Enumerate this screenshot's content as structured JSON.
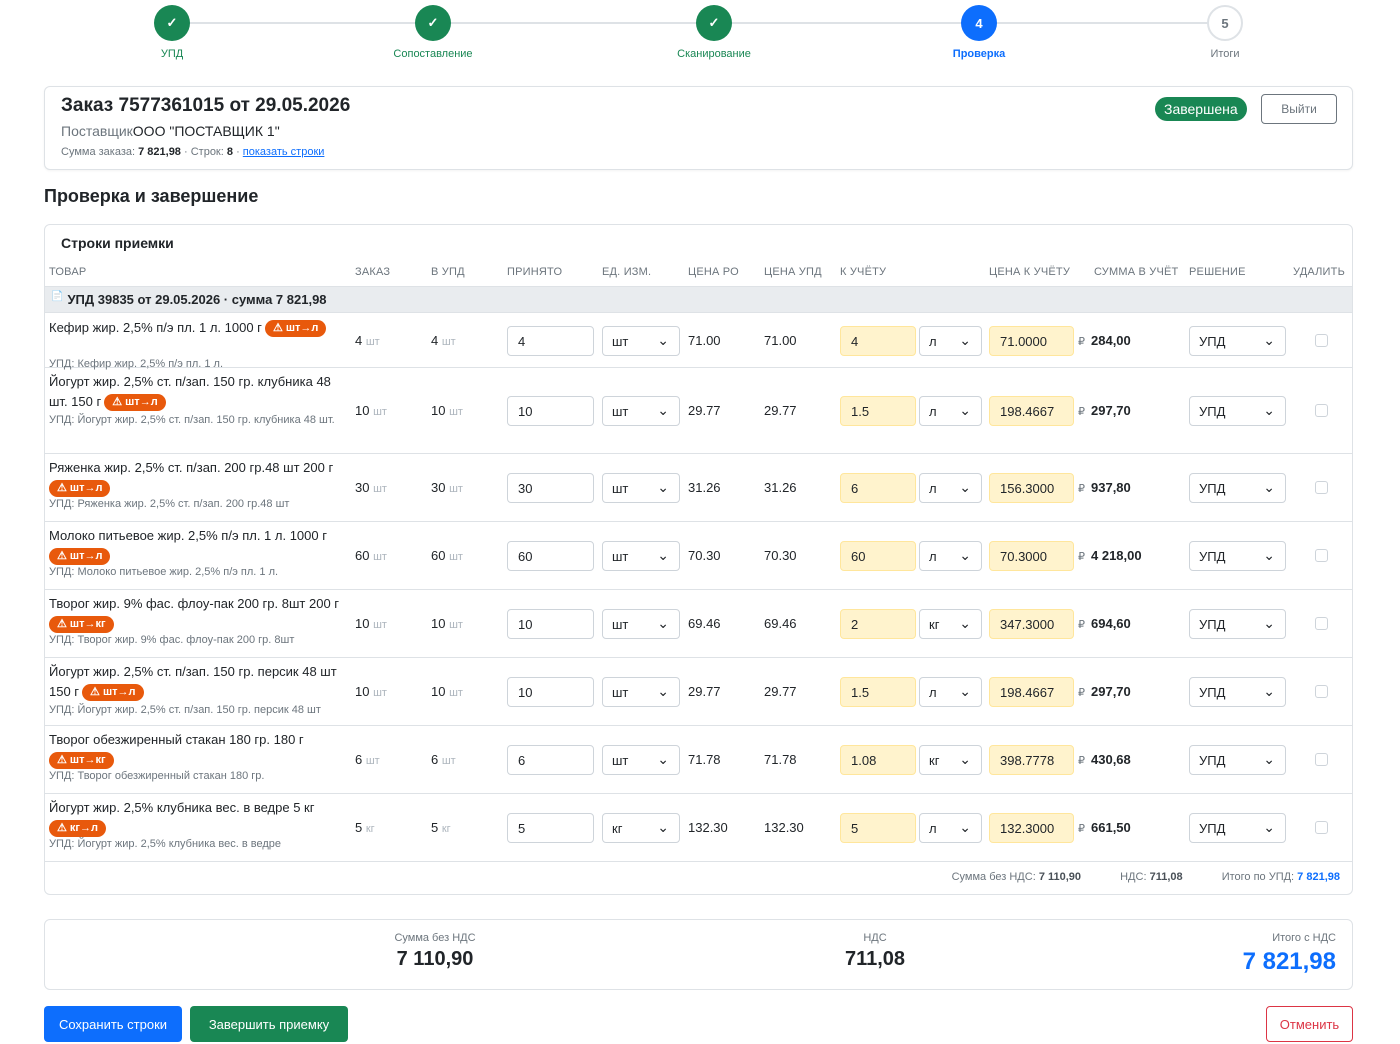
{
  "stepper": {
    "steps": [
      {
        "num": "✓",
        "label": "УПД",
        "state": "done"
      },
      {
        "num": "✓",
        "label": "Сопоставление",
        "state": "done"
      },
      {
        "num": "✓",
        "label": "Сканирование",
        "state": "done"
      },
      {
        "num": "4",
        "label": "Проверка",
        "state": "active"
      },
      {
        "num": "5",
        "label": "Итоги",
        "state": "pending"
      }
    ]
  },
  "order": {
    "title": "Заказ 7577361015 от 29.05.2026",
    "supplier_label": "Поставщик",
    "supplier_name": "ООО \"ПОСТАВЩИК 1\"",
    "sum_label": "Сумма заказа:",
    "sum_value": "7 821,98",
    "rows_label": "· Строк:",
    "rows_value": "8",
    "sep": "·",
    "show_rows_link": "показать строки",
    "status_badge": "Завершена",
    "exit_button": "Выйти"
  },
  "section_title": "Проверка и завершение",
  "table": {
    "card_title": "Строки приемки",
    "headers": {
      "product": "ТОВАР",
      "order": "ЗАКАЗ",
      "upd": "В УПД",
      "accepted": "ПРИНЯТО",
      "unit": "ЕД. ИЗМ.",
      "price_po": "ЦЕНА РО",
      "price_upd": "ЦЕНА УПД",
      "to_account": "К УЧЁТУ",
      "price_account": "ЦЕНА К УЧЁТУ",
      "sum_account": "СУММА В УЧЁТ",
      "decision": "РЕШЕНИЕ",
      "delete": "УДАЛИТЬ"
    },
    "group_label": "УПД 39835 от 29.05.2026 · сумма 7 821,98",
    "rows": [
      {
        "name": "Кефир жир. 2,5% п/э пл. 1 л. 1000 г",
        "badge": "⚠ шт→л",
        "upd_name": "УПД: Кефир жир. 2,5% п/э пл. 1 л.",
        "order_qty": "4",
        "order_unit": "шт",
        "upd_qty": "4",
        "upd_unit": "шт",
        "accepted": "4",
        "unit": "шт",
        "price_po": "71.00",
        "price_upd": "71.00",
        "to_account": "4",
        "account_unit": "л",
        "price_account": "71.0000",
        "sum": "284,00",
        "decision": "УПД"
      },
      {
        "name": "Йогурт жир. 2,5% ст. п/зап. 150 гр. клубника 48 шт. 150 г",
        "badge": "⚠ шт→л",
        "upd_name": "УПД: Йогурт жир. 2,5% ст. п/зап. 150 гр. клубника 48 шт.",
        "order_qty": "10",
        "order_unit": "шт",
        "upd_qty": "10",
        "upd_unit": "шт",
        "accepted": "10",
        "unit": "шт",
        "price_po": "29.77",
        "price_upd": "29.77",
        "to_account": "1.5",
        "account_unit": "л",
        "price_account": "198.4667",
        "sum": "297,70",
        "decision": "УПД"
      },
      {
        "name": "Ряженка жир. 2,5% ст. п/зап. 200 гр.48 шт 200 г",
        "badge": "⚠ шт→л",
        "upd_name": "УПД: Ряженка жир. 2,5% ст. п/зап. 200 гр.48 шт",
        "order_qty": "30",
        "order_unit": "шт",
        "upd_qty": "30",
        "upd_unit": "шт",
        "accepted": "30",
        "unit": "шт",
        "price_po": "31.26",
        "price_upd": "31.26",
        "to_account": "6",
        "account_unit": "л",
        "price_account": "156.3000",
        "sum": "937,80",
        "decision": "УПД"
      },
      {
        "name": "Молоко питьевое жир. 2,5% п/э пл. 1 л. 1000 г",
        "badge": "⚠ шт→л",
        "upd_name": "УПД: Молоко питьевое жир. 2,5% п/э пл. 1 л.",
        "order_qty": "60",
        "order_unit": "шт",
        "upd_qty": "60",
        "upd_unit": "шт",
        "accepted": "60",
        "unit": "шт",
        "price_po": "70.30",
        "price_upd": "70.30",
        "to_account": "60",
        "account_unit": "л",
        "price_account": "70.3000",
        "sum": "4 218,00",
        "decision": "УПД"
      },
      {
        "name": "Творог жир. 9% фас. флоу-пак 200 гр. 8шт 200 г",
        "badge": "⚠ шт→кг",
        "upd_name": "УПД: Творог жир. 9% фас. флоу-пак 200 гр. 8шт",
        "order_qty": "10",
        "order_unit": "шт",
        "upd_qty": "10",
        "upd_unit": "шт",
        "accepted": "10",
        "unit": "шт",
        "price_po": "69.46",
        "price_upd": "69.46",
        "to_account": "2",
        "account_unit": "кг",
        "price_account": "347.3000",
        "sum": "694,60",
        "decision": "УПД"
      },
      {
        "name": "Йогурт жир. 2,5% ст. п/зап. 150 гр. персик 48 шт 150 г",
        "badge": "⚠ шт→л",
        "upd_name": "УПД: Йогурт жир. 2,5% ст. п/зап. 150 гр. персик 48 шт",
        "order_qty": "10",
        "order_unit": "шт",
        "upd_qty": "10",
        "upd_unit": "шт",
        "accepted": "10",
        "unit": "шт",
        "price_po": "29.77",
        "price_upd": "29.77",
        "to_account": "1.5",
        "account_unit": "л",
        "price_account": "198.4667",
        "sum": "297,70",
        "decision": "УПД"
      },
      {
        "name": "Творог обезжиренный стакан 180 гр. 180 г",
        "badge": "⚠ шт→кг",
        "upd_name": "УПД: Творог обезжиренный стакан 180 гр.",
        "order_qty": "6",
        "order_unit": "шт",
        "upd_qty": "6",
        "upd_unit": "шт",
        "accepted": "6",
        "unit": "шт",
        "price_po": "71.78",
        "price_upd": "71.78",
        "to_account": "1.08",
        "account_unit": "кг",
        "price_account": "398.7778",
        "sum": "430,68",
        "decision": "УПД"
      },
      {
        "name": "Йогурт жир. 2,5% клубника вес. в ведре 5 кг",
        "badge": "⚠ кг→л",
        "upd_name": "УПД: Йогурт жир. 2,5% клубника вес. в ведре",
        "order_qty": "5",
        "order_unit": "кг",
        "upd_qty": "5",
        "upd_unit": "кг",
        "accepted": "5",
        "unit": "кг",
        "price_po": "132.30",
        "price_upd": "132.30",
        "to_account": "5",
        "account_unit": "л",
        "price_account": "132.3000",
        "sum": "661,50",
        "decision": "УПД"
      }
    ],
    "rub_sign": "₽",
    "footer": {
      "no_vat_label": "Сумма без НДС:",
      "no_vat_value": "7 110,90",
      "vat_label": "НДС:",
      "vat_value": "711,08",
      "total_label": "Итого по УПД:",
      "total_value": "7 821,98"
    }
  },
  "totals": {
    "no_vat_label": "Сумма без НДС",
    "no_vat_value": "7 110,90",
    "vat_label": "НДС",
    "vat_value": "711,08",
    "total_label": "Итого с НДС",
    "total_value": "7 821,98"
  },
  "buttons": {
    "save": "Сохранить строки",
    "finish": "Завершить приемку",
    "cancel": "Отменить"
  },
  "colors": {
    "primary": "#0d6efd",
    "success": "#198754",
    "warning_badge": "#e8590c",
    "danger": "#dc3545",
    "highlight_input": "#fff3cd"
  }
}
